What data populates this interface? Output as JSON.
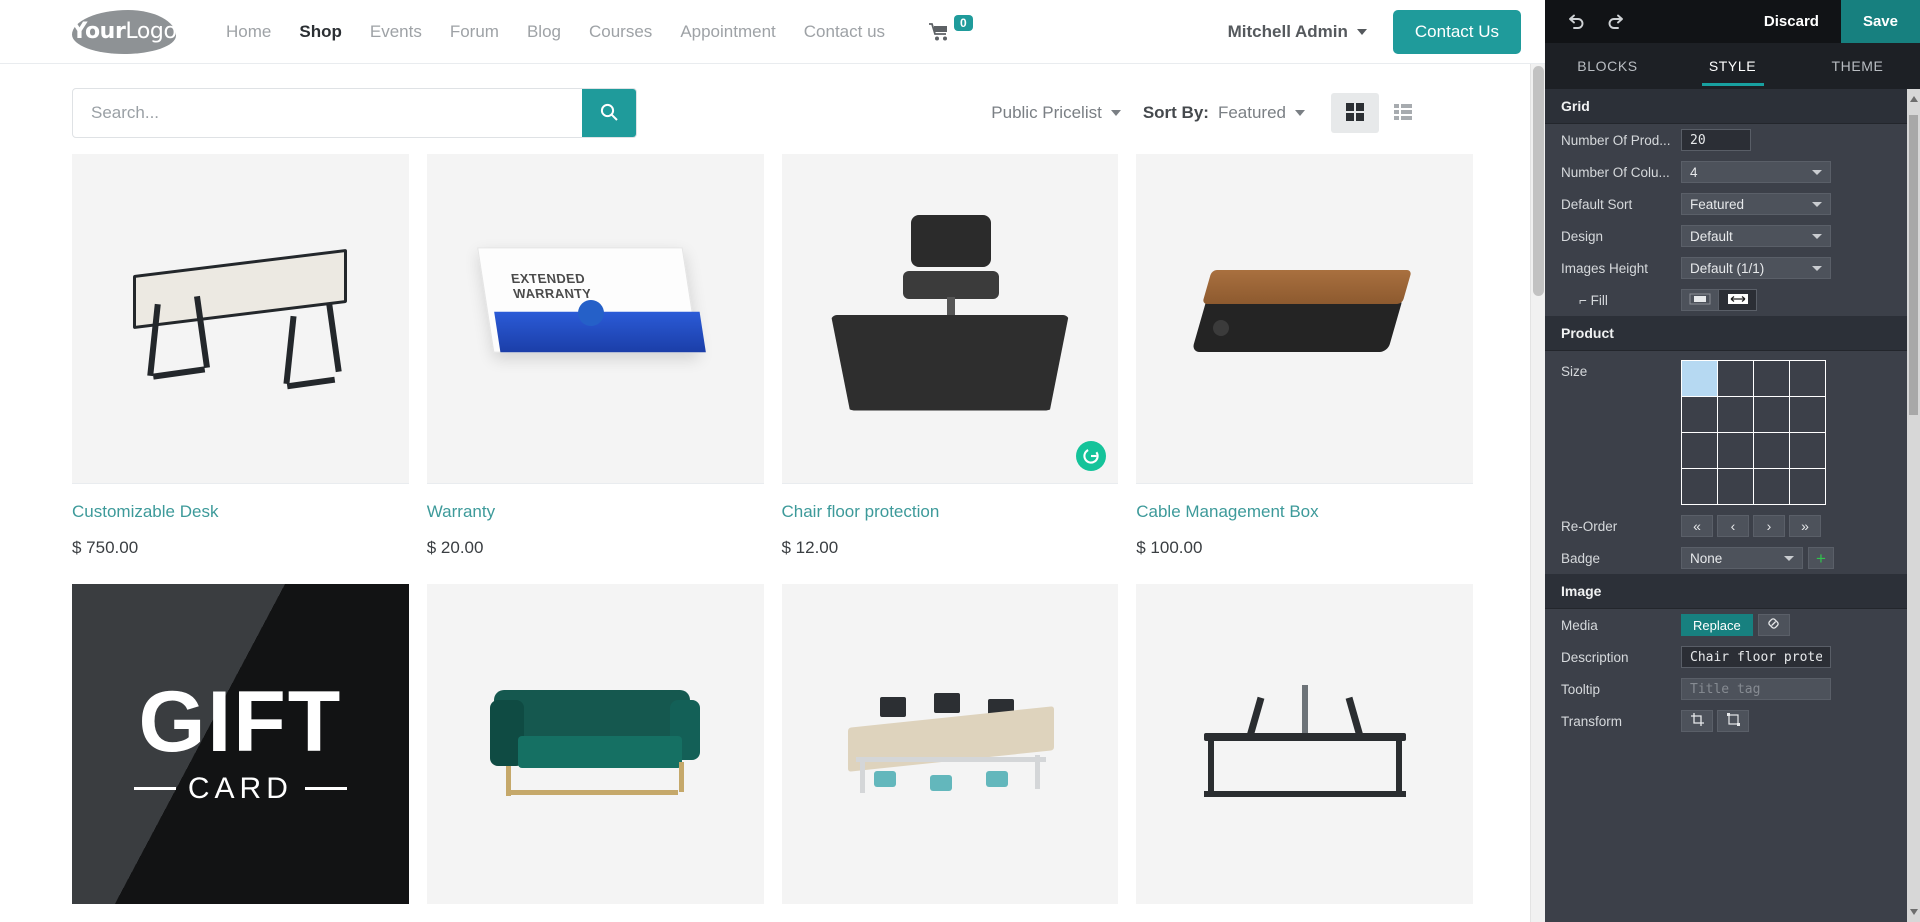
{
  "site": {
    "logo": {
      "bold": "Your",
      "light": "Logo"
    },
    "nav": [
      {
        "label": "Home",
        "active": false
      },
      {
        "label": "Shop",
        "active": true
      },
      {
        "label": "Events",
        "active": false
      },
      {
        "label": "Forum",
        "active": false
      },
      {
        "label": "Blog",
        "active": false
      },
      {
        "label": "Courses",
        "active": false
      },
      {
        "label": "Appointment",
        "active": false
      },
      {
        "label": "Contact us",
        "active": false
      }
    ],
    "cart": {
      "icon": "cart-icon",
      "count": "0"
    },
    "user": {
      "name": "Mitchell Admin",
      "icon": "chevron-down-icon"
    },
    "contact_button": "Contact Us",
    "accent_color": "#1f9b9b"
  },
  "toolbar": {
    "search": {
      "value": "",
      "placeholder": "Search...",
      "icon": "search-icon"
    },
    "pricelist": {
      "label": "Public Pricelist",
      "icon": "chevron-down-icon"
    },
    "sort": {
      "label": "Sort By:",
      "value": "Featured",
      "icon": "chevron-down-icon"
    },
    "views": [
      {
        "name": "grid-view-icon",
        "active": true
      },
      {
        "name": "list-view-icon",
        "active": false
      }
    ]
  },
  "products": [
    {
      "name": "Customizable Desk",
      "price": "$ 750.00",
      "art": "desk",
      "badge": null
    },
    {
      "name": "Warranty",
      "price": "$ 20.00",
      "art": "warranty",
      "badge": null,
      "art_text": {
        "line1": "EXTENDED",
        "line2": "WARRANTY"
      }
    },
    {
      "name": "Chair floor protection",
      "price": "$ 12.00",
      "art": "mat",
      "badge": "grammarly-icon"
    },
    {
      "name": "Cable Management Box",
      "price": "$ 100.00",
      "art": "cable",
      "badge": null
    },
    {
      "name": "",
      "price": "",
      "art": "giftcard",
      "badge": null,
      "art_text": {
        "line1": "GIFT",
        "line2": "CARD"
      }
    },
    {
      "name": "",
      "price": "",
      "art": "sofa",
      "badge": null
    },
    {
      "name": "",
      "price": "",
      "art": "conference",
      "badge": null
    },
    {
      "name": "",
      "price": "",
      "art": "monitor",
      "badge": null
    }
  ],
  "editor": {
    "topbar": {
      "undo_icon": "undo-icon",
      "redo_icon": "redo-icon",
      "discard": "Discard",
      "save": "Save",
      "save_color": "#17807f"
    },
    "tabs": [
      {
        "label": "BLOCKS",
        "active": false
      },
      {
        "label": "STYLE",
        "active": true
      },
      {
        "label": "THEME",
        "active": false
      }
    ],
    "sections": [
      {
        "title": "Grid",
        "rows": [
          {
            "label": "Number Of Prod...",
            "type": "text",
            "value": "20"
          },
          {
            "label": "Number Of Colu...",
            "type": "select",
            "value": "4"
          },
          {
            "label": "Default Sort",
            "type": "select",
            "value": "Featured"
          },
          {
            "label": "Design",
            "type": "select",
            "value": "Default"
          },
          {
            "label": "Images Height",
            "type": "select",
            "value": "Default (1/1)"
          },
          {
            "label": "⌐ Fill",
            "type": "iconbuttons",
            "indent": true,
            "buttons": [
              {
                "name": "image-contain-icon",
                "active": true
              },
              {
                "name": "image-stretch-icon",
                "active": false
              }
            ]
          }
        ]
      },
      {
        "title": "Product",
        "rows": [
          {
            "label": "Size",
            "type": "sizegrid",
            "cols": 4,
            "rows": 4,
            "selected": [
              0,
              0
            ]
          },
          {
            "label": "Re-Order",
            "type": "buttons",
            "buttons": [
              {
                "name": "move-first-button",
                "glyph": "«"
              },
              {
                "name": "move-prev-button",
                "glyph": "‹"
              },
              {
                "name": "move-next-button",
                "glyph": "›"
              },
              {
                "name": "move-last-button",
                "glyph": "»"
              }
            ]
          },
          {
            "label": "Badge",
            "type": "select-plus",
            "value": "None",
            "plus_icon": "plus-icon"
          }
        ]
      },
      {
        "title": "Image",
        "rows": [
          {
            "label": "Media",
            "type": "replace",
            "button": "Replace",
            "link_icon": "link-icon"
          },
          {
            "label": "Description",
            "type": "text-wide",
            "value": "Chair floor protect",
            "placeholder": ""
          },
          {
            "label": "Tooltip",
            "type": "text-wide",
            "value": "",
            "placeholder": "Title tag"
          },
          {
            "label": "Transform",
            "type": "iconbuttons2",
            "buttons": [
              {
                "name": "crop-icon"
              },
              {
                "name": "transform-icon"
              }
            ]
          }
        ]
      }
    ]
  }
}
